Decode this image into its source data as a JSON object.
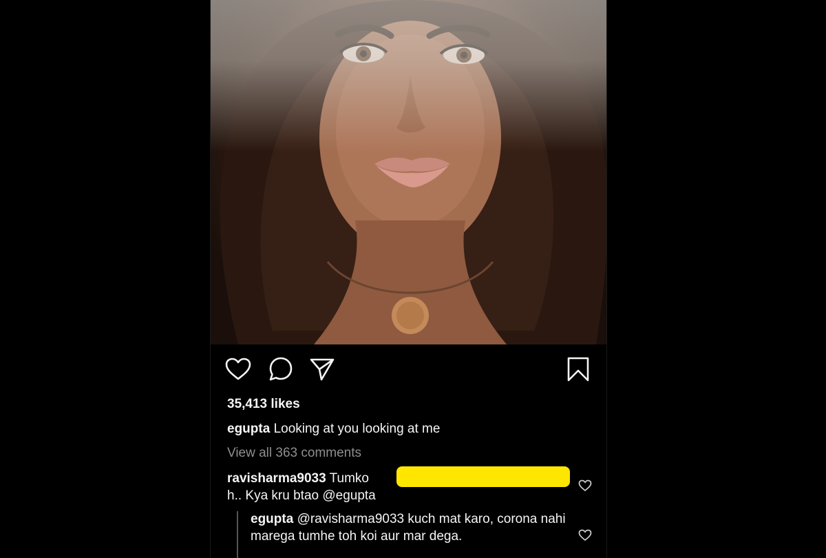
{
  "post": {
    "likes": "35,413 likes",
    "caption_user": "egupta",
    "caption_text": "Looking at you looking at me",
    "view_all": "View all 363 comments"
  },
  "comments": [
    {
      "user": "ravisharma9033",
      "text_start": "Tumko",
      "text_end": "h.. Kya kru btao @egupta",
      "redacted": true,
      "redaction_color": "#ffe600"
    }
  ],
  "replies": [
    {
      "user": "egupta",
      "text": "@ravisharma9033 kuch mat karo, corona nahi marega tumhe toh koi aur mar dega."
    }
  ],
  "icons": {
    "like": "heart-icon",
    "comment": "comment-bubble-icon",
    "share": "send-icon",
    "save": "bookmark-icon"
  },
  "colors": {
    "background": "#000000",
    "text": "#f5f5f5",
    "muted": "#8e8e8e"
  }
}
